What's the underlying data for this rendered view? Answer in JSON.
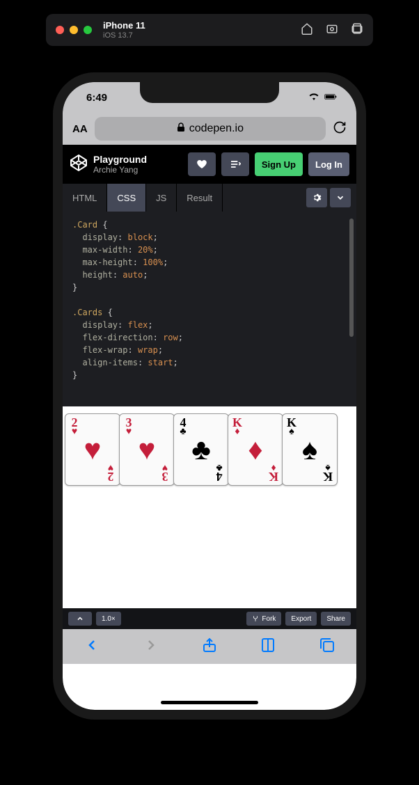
{
  "simulator": {
    "device_name": "iPhone 11",
    "os_version": "iOS 13.7"
  },
  "status": {
    "time": "6:49"
  },
  "safari": {
    "aa_label": "AA",
    "domain": "codepen.io"
  },
  "codepen": {
    "pen_title": "Playground",
    "author": "Archie Yang",
    "signup_label": "Sign Up",
    "login_label": "Log In"
  },
  "tabs": {
    "html": "HTML",
    "css": "CSS",
    "js": "JS",
    "result": "Result",
    "active": "CSS"
  },
  "code_css": [
    {
      "sel": ".Card",
      "rules": [
        {
          "p": "display",
          "v": "block"
        },
        {
          "p": "max-width",
          "v": "20%"
        },
        {
          "p": "max-height",
          "v": "100%"
        },
        {
          "p": "height",
          "v": "auto"
        }
      ]
    },
    {
      "sel": ".Cards",
      "rules": [
        {
          "p": "display",
          "v": "flex"
        },
        {
          "p": "flex-direction",
          "v": "row"
        },
        {
          "p": "flex-wrap",
          "v": "wrap"
        },
        {
          "p": "align-items",
          "v": "start"
        }
      ]
    }
  ],
  "cards": [
    {
      "rank": "2",
      "suit": "♥",
      "color": "red"
    },
    {
      "rank": "3",
      "suit": "♥",
      "color": "red"
    },
    {
      "rank": "4",
      "suit": "♣",
      "color": "black"
    },
    {
      "rank": "K",
      "suit": "♦",
      "color": "red"
    },
    {
      "rank": "K",
      "suit": "♠",
      "color": "black"
    }
  ],
  "bottom_bar": {
    "zoom": "1.0×",
    "fork": "Fork",
    "export": "Export",
    "share": "Share"
  }
}
